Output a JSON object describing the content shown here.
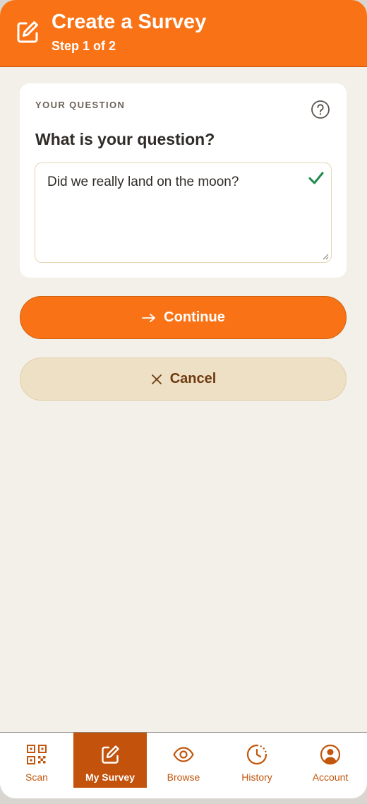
{
  "header": {
    "title": "Create a Survey",
    "subtitle": "Step 1 of 2",
    "icon": "edit-icon"
  },
  "question_card": {
    "section_label": "YOUR QUESTION",
    "help_icon": "help-circle-icon",
    "prompt": "What is your question?",
    "answer_value": "Did we really land on the moon?",
    "valid_icon": "checkmark-icon"
  },
  "actions": {
    "continue_label": "Continue",
    "continue_icon": "arrow-right-icon",
    "cancel_label": "Cancel",
    "cancel_icon": "close-icon"
  },
  "nav": {
    "items": [
      {
        "label": "Scan",
        "icon": "qr-code-icon",
        "active": false
      },
      {
        "label": "My Survey",
        "icon": "edit-icon",
        "active": true
      },
      {
        "label": "Browse",
        "icon": "eye-icon",
        "active": false
      },
      {
        "label": "History",
        "icon": "history-clock-icon",
        "active": false
      },
      {
        "label": "Account",
        "icon": "user-circle-icon",
        "active": false
      }
    ]
  },
  "colors": {
    "brand": "#f97316",
    "brand_dark": "#c2520c",
    "background": "#f3f0e9",
    "cancel_bg": "#eee0c5",
    "success": "#1f8a4c"
  }
}
